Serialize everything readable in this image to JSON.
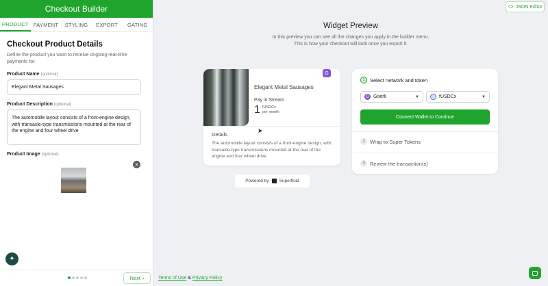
{
  "sidebar": {
    "title": "Checkout Builder",
    "tabs": [
      {
        "label": "PRODUCT",
        "active": true
      },
      {
        "label": "PAYMENT",
        "active": false
      },
      {
        "label": "STYLING",
        "active": false
      },
      {
        "label": "EXPORT",
        "active": false
      },
      {
        "label": "GATING",
        "active": false
      }
    ],
    "heading": "Checkout Product Details",
    "subheading": "Define the product you want to receive ongoing real-time payments for.",
    "product_name_label": "Product Name",
    "product_name_opt": "(optional)",
    "product_name_value": "Elegant Metal Sausages",
    "product_desc_label": "Product Description",
    "product_desc_opt": "(optional)",
    "product_desc_value": "The automobile layout consists of a front-engine design, with transaxle-type transmissions mounted at the rear of the engine and four wheel drive",
    "product_image_label": "Product Image",
    "product_image_opt": "(optional)",
    "next_label": "Next",
    "page_dots": 5,
    "page_current": 1
  },
  "header": {
    "json_editor_label": "JSON Editor"
  },
  "preview": {
    "title": "Widget Preview",
    "subtitle_line1": "In this preview you can see all the changes you apply in the builder menu.",
    "subtitle_line2": "This is how your checkout will look once you export it."
  },
  "product_card": {
    "badge": "G",
    "name": "Elegant Metal Sausages",
    "pay_label": "Pay in Stream",
    "amount": "1",
    "unit_line1": "fUSDCx",
    "unit_line2": "per month",
    "details_heading": "Details",
    "details_text": "The automobile layout consists of a front-engine design, with transaxle-type transmissions mounted at the rear of the engine and four wheel drive"
  },
  "powered_by": {
    "label": "Powered by",
    "brand": "Superfluid"
  },
  "steps": {
    "step1": {
      "num": "1",
      "label": "Select network and token"
    },
    "network": {
      "value": "Goerli",
      "icon_letter": "G"
    },
    "token": {
      "value": "fUSDCx"
    },
    "connect_label": "Connect Wallet to Continue",
    "step2": {
      "num": "2",
      "label": "Wrap to Super Tokens"
    },
    "step3": {
      "num": "3",
      "label": "Review the transaction(s)"
    }
  },
  "footer": {
    "terms": "Terms of Use",
    "amp": "&",
    "privacy": "Privacy Policy"
  },
  "colors": {
    "brand": "#1fa52d",
    "network_icon": "#8a54d6"
  }
}
